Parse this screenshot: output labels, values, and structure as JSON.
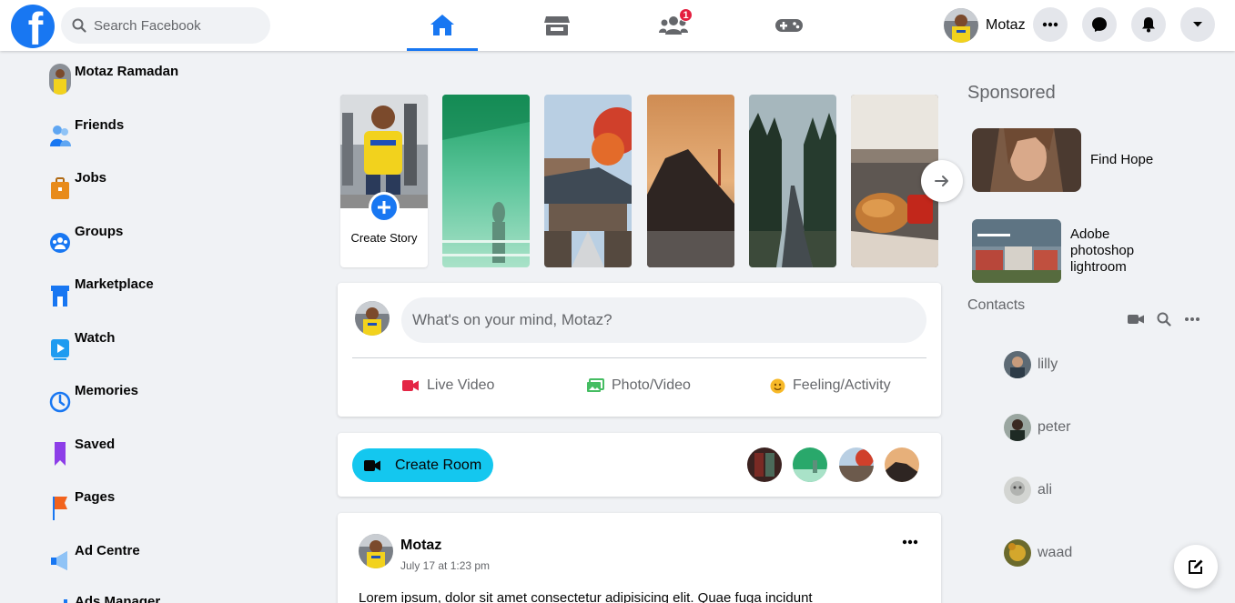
{
  "brand": {
    "logo_letter": "f",
    "accent": "#1877f2"
  },
  "search": {
    "placeholder": "Search Facebook"
  },
  "nav": {
    "tabs": [
      {
        "icon": "home-icon",
        "active": true
      },
      {
        "icon": "marketplace-store-icon",
        "active": false
      },
      {
        "icon": "groups-icon",
        "active": false,
        "badge": "1"
      },
      {
        "icon": "gaming-controller-icon",
        "active": false
      }
    ]
  },
  "header_profile": {
    "name": "Motaz"
  },
  "header_buttons": [
    "more-dots-icon",
    "messenger-icon",
    "notifications-bell-icon",
    "account-caret-icon"
  ],
  "sidebar": {
    "items": [
      {
        "label": "Motaz Ramadan",
        "icon": "avatar"
      },
      {
        "label": "Friends",
        "icon": "friends-icon"
      },
      {
        "label": "Jobs",
        "icon": "briefcase-icon"
      },
      {
        "label": "Groups",
        "icon": "groups-icon"
      },
      {
        "label": "Marketplace",
        "icon": "store-icon"
      },
      {
        "label": "Watch",
        "icon": "play-icon"
      },
      {
        "label": "Memories",
        "icon": "clock-icon"
      },
      {
        "label": "Saved",
        "icon": "bookmark-icon"
      },
      {
        "label": "Pages",
        "icon": "flag-icon"
      },
      {
        "label": "Ad Centre",
        "icon": "megaphone-icon"
      },
      {
        "label": "Ads Manager",
        "icon": "chart-icon"
      }
    ]
  },
  "stories": {
    "create_label": "Create Story"
  },
  "composer": {
    "placeholder": "What's on your mind, Motaz?",
    "actions": [
      {
        "label": "Live Video",
        "icon": "video-camera-icon",
        "color": "#e42645"
      },
      {
        "label": "Photo/Video",
        "icon": "photo-icon",
        "color": "#45bd62"
      },
      {
        "label": "Feeling/Activity",
        "icon": "smiley-icon",
        "color": "#f7b928"
      }
    ]
  },
  "room": {
    "button_label": "Create Room",
    "button_color": "#14c7ef"
  },
  "post": {
    "author": "Motaz",
    "time": "July 17 at 1:23 pm",
    "text": "Lorem ipsum, dolor sit amet consectetur adipisicing elit. Quae fuga incidunt"
  },
  "sponsored": {
    "title": "Sponsored",
    "items": [
      {
        "label_lines": [
          "Find Hope"
        ]
      },
      {
        "label_lines": [
          "Adobe",
          "photoshop",
          "lightroom"
        ]
      }
    ]
  },
  "contacts": {
    "title": "Contacts",
    "people": [
      "lilly",
      "peter",
      "ali",
      "waad"
    ]
  }
}
